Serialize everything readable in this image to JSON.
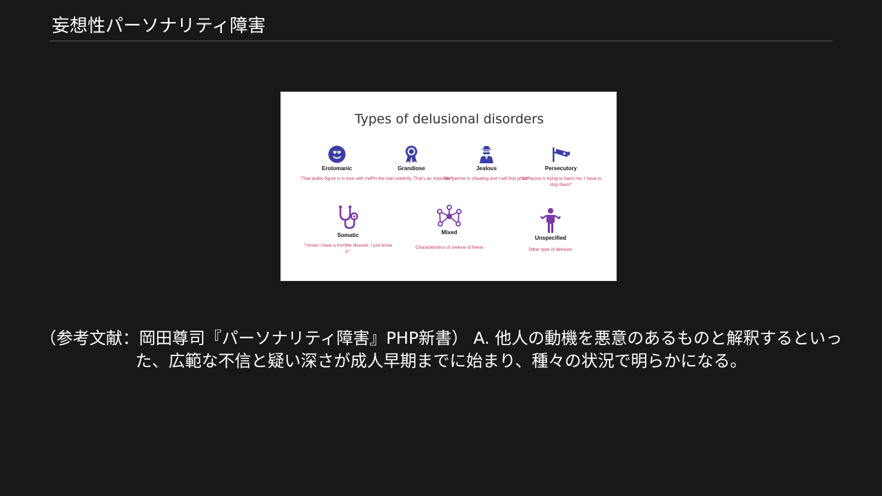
{
  "header": {
    "title": "妄想性パーソナリティ障害"
  },
  "slide": {
    "title": "Types of delusional disorders",
    "colors": {
      "icon_blue": "#3b3fa3",
      "icon_purple": "#7b3aa8",
      "desc_red": "#c0305a"
    },
    "items": [
      {
        "name": "Erotomanic",
        "desc": "“That public figure is in love with me!”",
        "icon": "heart-eyes-face-icon"
      },
      {
        "name": "Grandiose",
        "desc": "“I’m the real celebrity. That’s an imposter!”",
        "icon": "award-ribbon-icon"
      },
      {
        "name": "Jealous",
        "desc": "“My partner is cheating and I will find proof!”",
        "icon": "detective-icon"
      },
      {
        "name": "Persecutory",
        "desc": "“Someone is trying to harm me. I have to stop them!”",
        "icon": "security-camera-icon"
      },
      {
        "name": "Somatic",
        "desc": "“I know I have a horrible disease, I just know it.”",
        "icon": "stethoscope-icon"
      },
      {
        "name": "Mixed",
        "desc": "Characteristics of several of these",
        "icon": "network-icon"
      },
      {
        "name": "Unspecified",
        "desc": "Other type of delusion",
        "icon": "person-shrug-icon"
      }
    ]
  },
  "caption": {
    "text": "（参考文献：岡田尊司『パーソナリティ障害』PHP新書） A. 他人の動機を悪意のあるものと解釈するといった、広範な不信と疑い深さが成人早期までに始まり、種々の状況で明らかになる。"
  }
}
